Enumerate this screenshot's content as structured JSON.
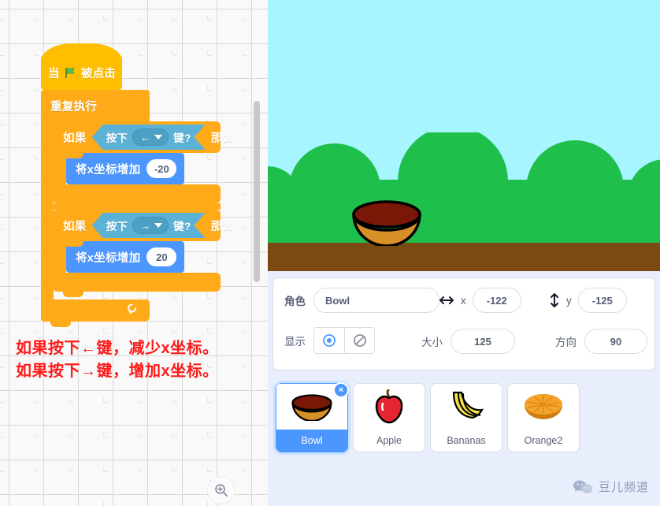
{
  "workspace": {
    "blocks": {
      "hat": {
        "prefix": "当",
        "icon": "green-flag-icon",
        "suffix": "被点击"
      },
      "repeat_forever": {
        "label": "重复执行",
        "loop_icon": "loop-arrow-icon"
      },
      "if_left": {
        "if_label": "如果",
        "then_label": "那么",
        "condition_prefix": "按下",
        "condition_suffix": "键?",
        "key": "←",
        "dropdown_icon": "chevron-down-icon"
      },
      "change_x_left": {
        "label": "将x坐标增加",
        "value": "-20"
      },
      "if_right": {
        "if_label": "如果",
        "then_label": "那么",
        "condition_prefix": "按下",
        "condition_suffix": "键?",
        "key": "→",
        "dropdown_icon": "chevron-down-icon"
      },
      "change_x_right": {
        "label": "将x坐标增加",
        "value": "20"
      }
    },
    "annotation": {
      "line1": "如果按下←键，减少x坐标。",
      "line2": "如果按下→键，增加x坐标。",
      "color": "#ff1a1a"
    },
    "zoom_in_icon": "zoom-in-icon",
    "scrollbar": "vertical-scrollbar"
  },
  "stage": {
    "backdrop_name": "hills-backdrop",
    "sky_color": "#a6f5ff",
    "hill_color": "#1fbf4b",
    "ground_color": "#7a4a12",
    "sprite_on_stage": "bowl-sprite"
  },
  "sprite_info": {
    "name_label": "角色",
    "name_value": "Bowl",
    "x_label": "x",
    "x_value": "-122",
    "y_label": "y",
    "y_value": "-125",
    "x_icon": "horizontal-arrows-icon",
    "y_icon": "vertical-arrows-icon",
    "show_label": "显示",
    "show_icon": "eye-icon",
    "hide_icon": "eye-crossed-icon",
    "size_label": "大小",
    "size_value": "125",
    "direction_label": "方向",
    "direction_value": "90"
  },
  "sprites": [
    {
      "name": "Bowl",
      "selected": true,
      "icon": "bowl-icon",
      "delete_badge": "×"
    },
    {
      "name": "Apple",
      "selected": false,
      "icon": "apple-icon"
    },
    {
      "name": "Bananas",
      "selected": false,
      "icon": "bananas-icon"
    },
    {
      "name": "Orange2",
      "selected": false,
      "icon": "orange-icon"
    }
  ],
  "watermark": {
    "icon": "wechat-icon",
    "text": "豆儿频道"
  }
}
